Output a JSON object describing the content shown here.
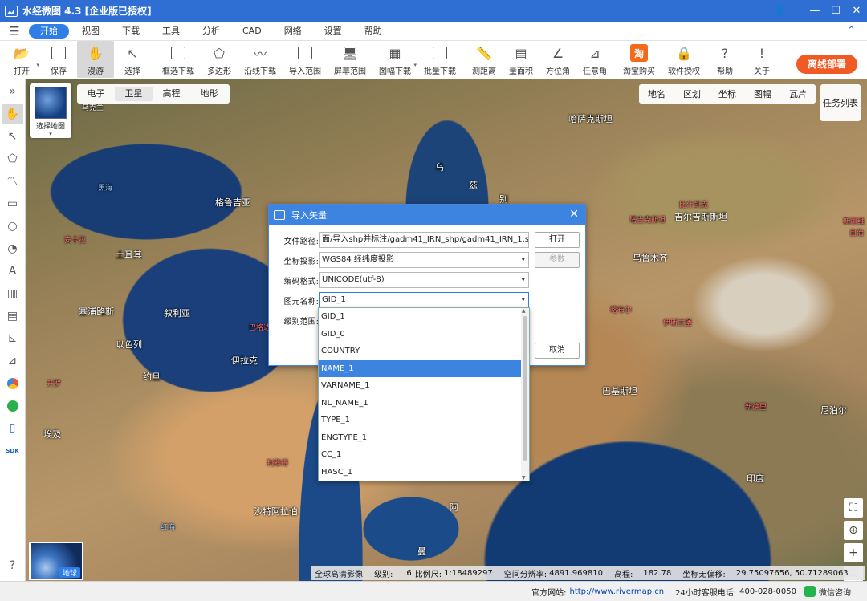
{
  "window": {
    "title": "水经微图 4.3 [企业版已授权]",
    "controls": [
      "—",
      "☐",
      "✕"
    ]
  },
  "menu": {
    "items": [
      "开始",
      "视图",
      "下载",
      "工具",
      "分析",
      "CAD",
      "网络",
      "设置",
      "帮助"
    ]
  },
  "toolbar": {
    "tools": [
      {
        "label": "打开",
        "icon": "folder-open-icon"
      },
      {
        "label": "保存",
        "icon": "save-icon"
      },
      {
        "label": "漫游",
        "icon": "hand-icon"
      },
      {
        "label": "选择",
        "icon": "cursor-icon"
      },
      {
        "label": "框选下载",
        "icon": "box-download-icon"
      },
      {
        "label": "多边形",
        "icon": "polygon-download-icon"
      },
      {
        "label": "沿线下载",
        "icon": "line-download-icon"
      },
      {
        "label": "导入范围",
        "icon": "import-range-icon"
      },
      {
        "label": "屏幕范围",
        "icon": "screen-range-icon"
      },
      {
        "label": "图幅下载",
        "icon": "sheet-download-icon"
      },
      {
        "label": "批量下载",
        "icon": "batch-download-icon"
      },
      {
        "label": "测距离",
        "icon": "measure-distance-icon"
      },
      {
        "label": "量面积",
        "icon": "measure-area-icon"
      },
      {
        "label": "方位角",
        "icon": "azimuth-icon"
      },
      {
        "label": "任意角",
        "icon": "arbitrary-angle-icon"
      },
      {
        "label": "淘宝购买",
        "icon": "taobao-icon"
      },
      {
        "label": "软件授权",
        "icon": "lock-icon"
      },
      {
        "label": "帮助",
        "icon": "help-icon"
      },
      {
        "label": "关于",
        "icon": "info-icon"
      }
    ],
    "offline_label": "离线部署"
  },
  "map": {
    "layer_selector_label": "选择地图",
    "map_types": [
      "电子",
      "卫星",
      "高程",
      "地形"
    ],
    "overlays": [
      "地名",
      "区划",
      "坐标",
      "图幅",
      "瓦片"
    ],
    "task_list_label": "任务列表",
    "globe_label": "地球",
    "labels": {
      "kazakhstan": "哈萨克斯坦",
      "ukraine": "乌克兰",
      "black_sea": "黑海",
      "georgia": "格鲁吉亚",
      "turkey": "土耳其",
      "ankara": "安卡拉",
      "cyprus": "塞浦路斯",
      "syria": "叙利亚",
      "israel": "以色列",
      "jordan": "约旦",
      "egypt": "埃及",
      "cairo": "开罗",
      "iraq": "伊拉克",
      "baghdad": "巴格达",
      "saudi": "沙特阿拉伯",
      "riyadh": "利雅得",
      "red_sea": "红海",
      "kyrgyzstan": "吉尔吉斯斯坦",
      "tajikistan": "塔吉克斯坦",
      "pakistan": "巴基斯坦",
      "nepal": "尼泊尔",
      "india": "印度",
      "new_delhi": "新德里",
      "islamabad": "伊斯兰堡",
      "kabul": "喀布尔",
      "bishkek": "比什凯克",
      "urumqi": "乌鲁木齐",
      "xinjiang": "新疆维",
      "uz1": "乌",
      "uz2": "兹",
      "uz3": "别",
      "oman": "阿",
      "yemen": "曼",
      "zi": "自治"
    },
    "status": {
      "imagery": "全球高清影像",
      "level_label": "级别:",
      "level": "6",
      "scale_label": "比例尺:",
      "scale": "1:18489297",
      "resolution_label": "空间分辨率:",
      "resolution": "4891.969810",
      "elevation_label": "高程:",
      "elevation": "182.78",
      "coord_label": "坐标无偏移:",
      "coords": "29.75097656, 50.71289063"
    }
  },
  "dialog": {
    "title": "导入矢量",
    "file_path_label": "文件路径:",
    "file_path": "面/导入shp并标注/gadm41_IRN_shp/gadm41_IRN_1.shp;",
    "open_button": "打开",
    "projection_label": "坐标投影:",
    "projection": "WGS84 经纬度投影",
    "params_button": "参数",
    "encoding_label": "编码格式:",
    "encoding": "UNICODE(utf-8)",
    "feature_name_label": "图元名称:",
    "feature_name": "GID_1",
    "level_range_label": "级别范围:",
    "cancel_button": "取消",
    "options": [
      "GID_1",
      "GID_0",
      "COUNTRY",
      "NAME_1",
      "VARNAME_1",
      "NL_NAME_1",
      "TYPE_1",
      "ENGTYPE_1",
      "CC_1",
      "HASC_1"
    ],
    "selected_option": "NAME_1"
  },
  "bottom": {
    "site_label": "官方网站:",
    "site_url": "http://www.rivermap.cn",
    "hotline_label": "24小时客服电话:",
    "hotline": "400-028-0050",
    "wechat_label": "微信咨询"
  }
}
